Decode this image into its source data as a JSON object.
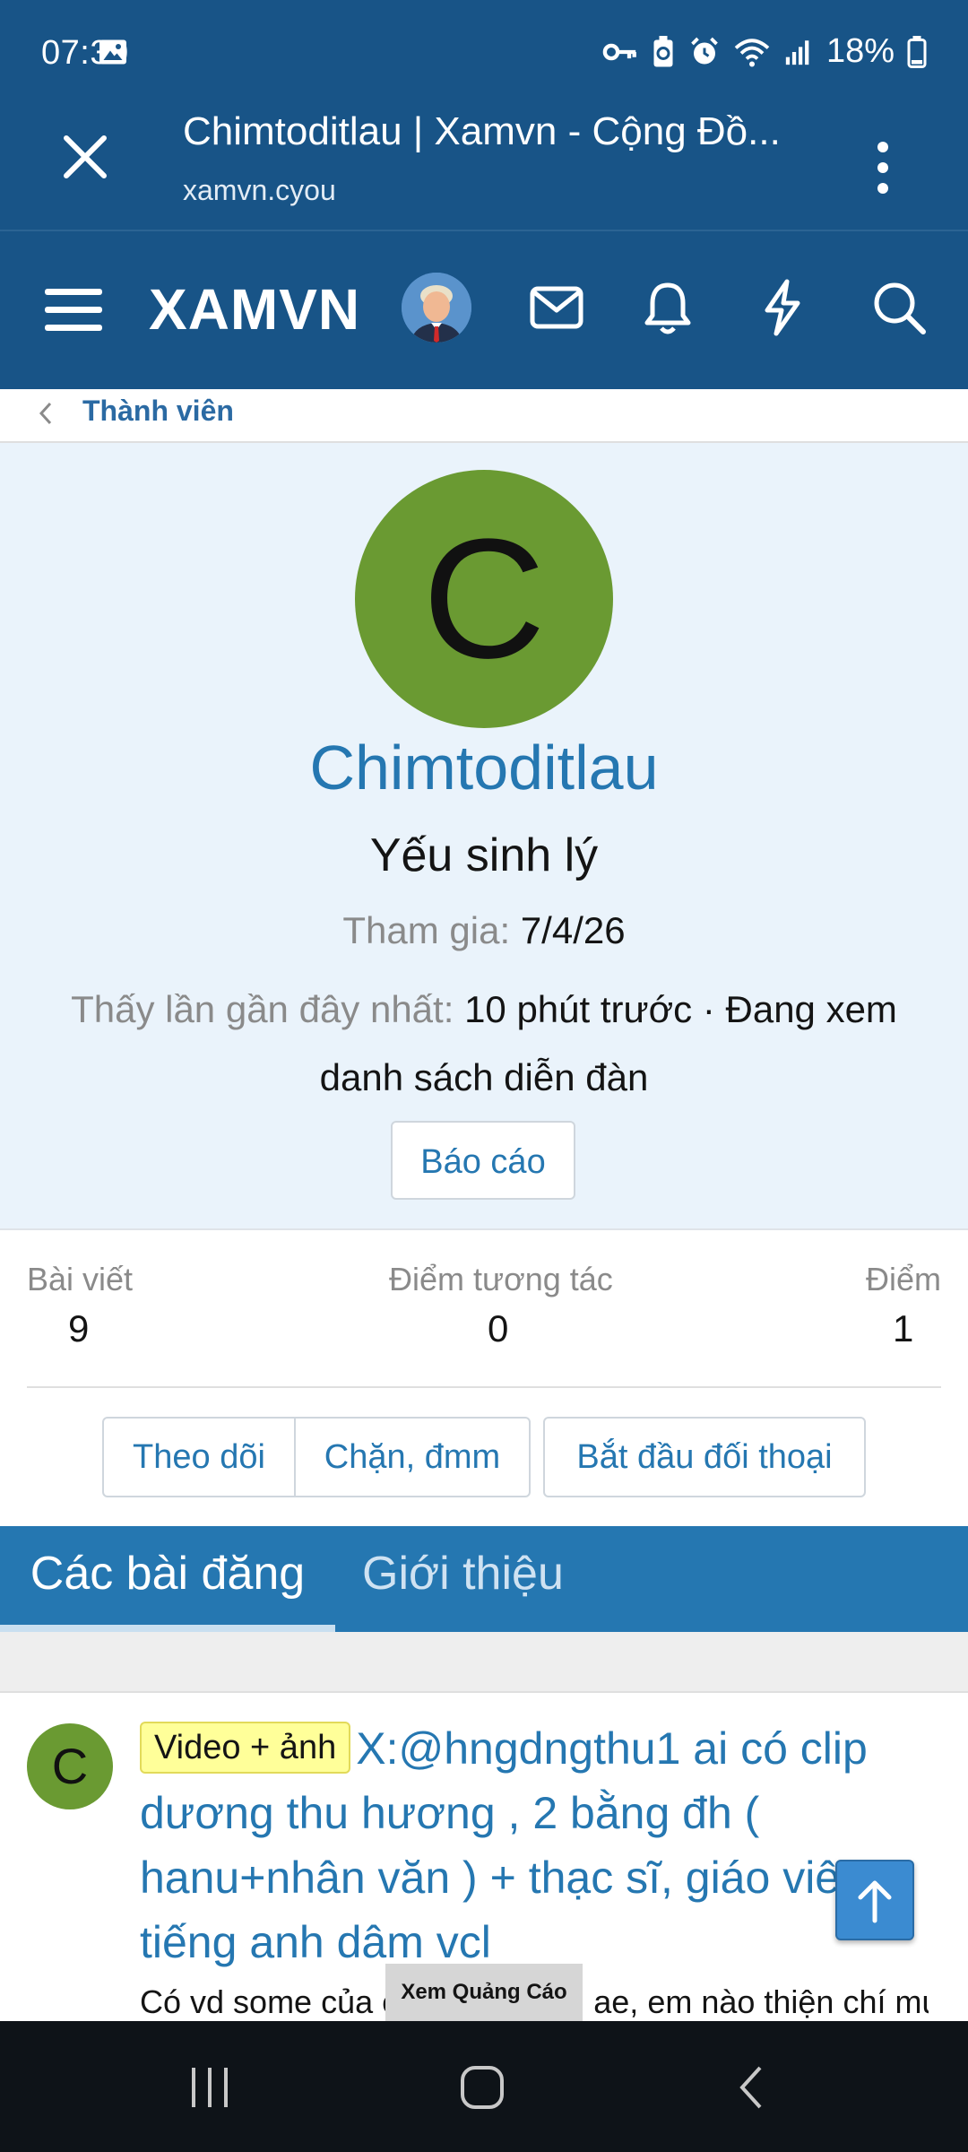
{
  "status_bar": {
    "time": "07:30",
    "battery": "18%",
    "icons": [
      "gallery-icon",
      "vpn-key-icon",
      "battery-saver-icon",
      "alarm-icon",
      "wifi-icon",
      "signal-icon",
      "battery-icon"
    ]
  },
  "browser_tab": {
    "title": "Chimtoditlau | Xamvn - Cộng Đồ...",
    "url": "xamvn.cyou"
  },
  "site_nav": {
    "logo": "XAMVN",
    "icons": [
      "hamburger-menu-icon",
      "user-avatar",
      "mail-icon",
      "bell-icon",
      "lightning-icon",
      "search-icon"
    ]
  },
  "breadcrumb": {
    "label": "Thành viên"
  },
  "profile": {
    "avatar_letter": "C",
    "avatar_color": "#6a9a32",
    "name": "Chimtoditlau",
    "title": "Yếu sinh lý",
    "joined_label": "Tham gia:",
    "joined_value": "7/4/26",
    "last_seen_label": "Thấy lần gần đây nhất:",
    "last_seen_value": "10 phút trước · Đang xem danh sách diễn đàn",
    "report_button": "Báo cáo"
  },
  "stats": [
    {
      "label": "Bài viết",
      "value": "9"
    },
    {
      "label": "Điểm tương tác",
      "value": "0"
    },
    {
      "label": "Điểm",
      "value": "1"
    }
  ],
  "actions": {
    "follow": "Theo dõi",
    "block": "Chặn, đmm",
    "start_conversation": "Bắt đầu đối thoại"
  },
  "tabs": [
    {
      "label": "Các bài đăng",
      "active": true
    },
    {
      "label": "Giới thiệu",
      "active": false
    }
  ],
  "posts": [
    {
      "avatar_letter": "C",
      "label": "Video + ảnh",
      "title": "X:@hngdngthu1 ai có clip dương thu hương , 2 bằng đh ( hanu+nhân văn ) + thạc sĩ, giáo viên tiếng anh dâm vcl",
      "snippet": "Có vd some của em này không ae, em nào thiện chí mua"
    }
  ],
  "ad_button": "Xem Quảng Cáo",
  "colors": {
    "header": "#185487",
    "link": "#2577b1",
    "profile_bg": "#eaf3fb",
    "tab_bar": "#2577b1",
    "label_bg": "#ffff99"
  }
}
